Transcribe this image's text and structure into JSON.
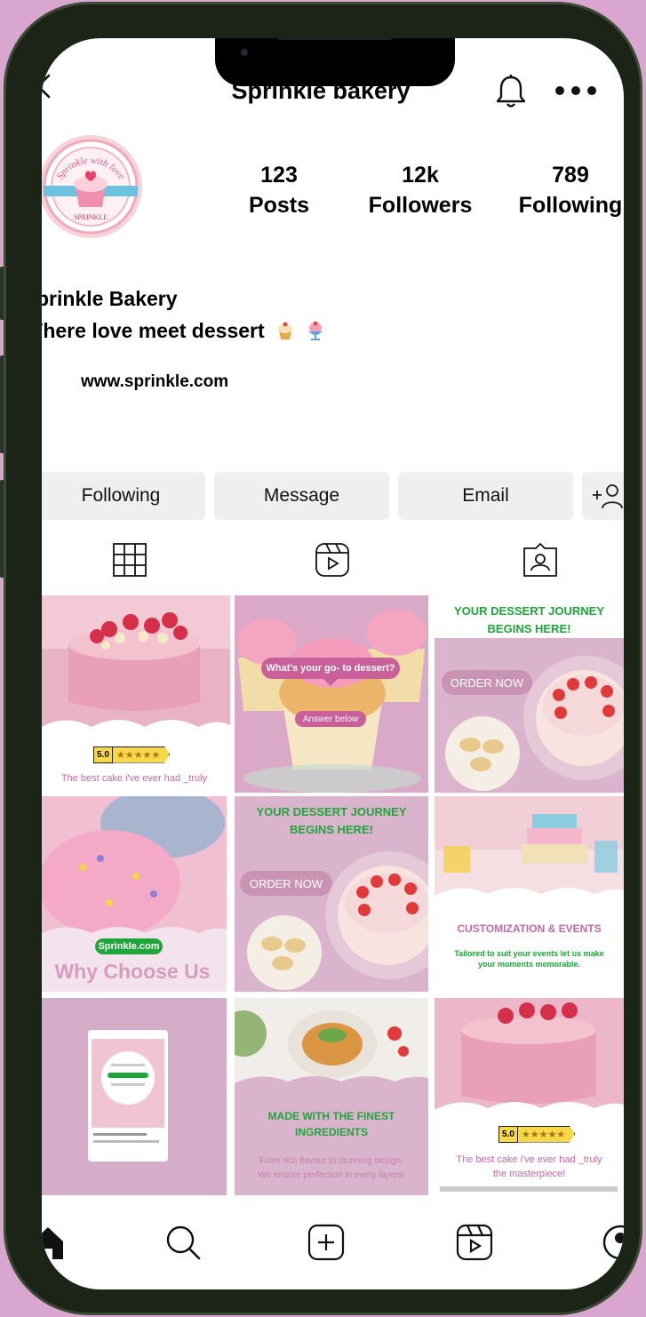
{
  "header": {
    "title": "Sprinkle bakery"
  },
  "avatar": {
    "ring_text": "Sprinkle with love",
    "ribbon_text": "SPRINKLE"
  },
  "stats": [
    {
      "value": "123",
      "label": "Posts"
    },
    {
      "value": "12k",
      "label": "Followers"
    },
    {
      "value": "789",
      "label": "Following"
    }
  ],
  "bio": {
    "name": "prinkle Bakery",
    "line": "Vhere love meet  dessert",
    "link": "www.sprinkle.com"
  },
  "actions": {
    "following_label": "Following",
    "message_label": "Message",
    "email_label": "Email"
  },
  "tabs": [
    "grid-icon",
    "reels-icon",
    "tagged-icon"
  ],
  "posts": {
    "p1": {
      "rating": "5.0",
      "caption": "The best cake i've ever had _truly"
    },
    "p2": {
      "question": "What's your go- to dessert?",
      "answer": "Answer below"
    },
    "p3": {
      "headline1": "YOUR DESSERT JOURNEY",
      "headline2": "BEGINS HERE!",
      "cta": "ORDER NOW"
    },
    "p4": {
      "badge": "Sprinkle.com",
      "headline": "Why Choose Us"
    },
    "p5": {
      "headline1": "YOUR DESSERT JOURNEY",
      "headline2": "BEGINS HERE!",
      "cta": "ORDER NOW"
    },
    "p6": {
      "headline": "CUSTOMIZATION & EVENTS",
      "body1": "Tailored to suit your events let us make",
      "body2": "your moments memorable."
    },
    "p8": {
      "headline1": "MADE WITH THE FINEST",
      "headline2": "INGREDIENTS",
      "body1": "From rich flavour to stunning design.",
      "body2": "We ensure perfection in every layers!"
    },
    "p9": {
      "rating": "5.0",
      "caption1": "The best cake i've ever had _truly",
      "caption2": "the masterpiece!"
    }
  },
  "nav": [
    "home-icon",
    "search-icon",
    "create-icon",
    "reels-icon",
    "profile-icon"
  ],
  "colors": {
    "frame": "#d8a6cf",
    "tile_pink": "#d7b2cb",
    "accent_green": "#1fa53a",
    "accent_pink": "#c06aa6"
  }
}
